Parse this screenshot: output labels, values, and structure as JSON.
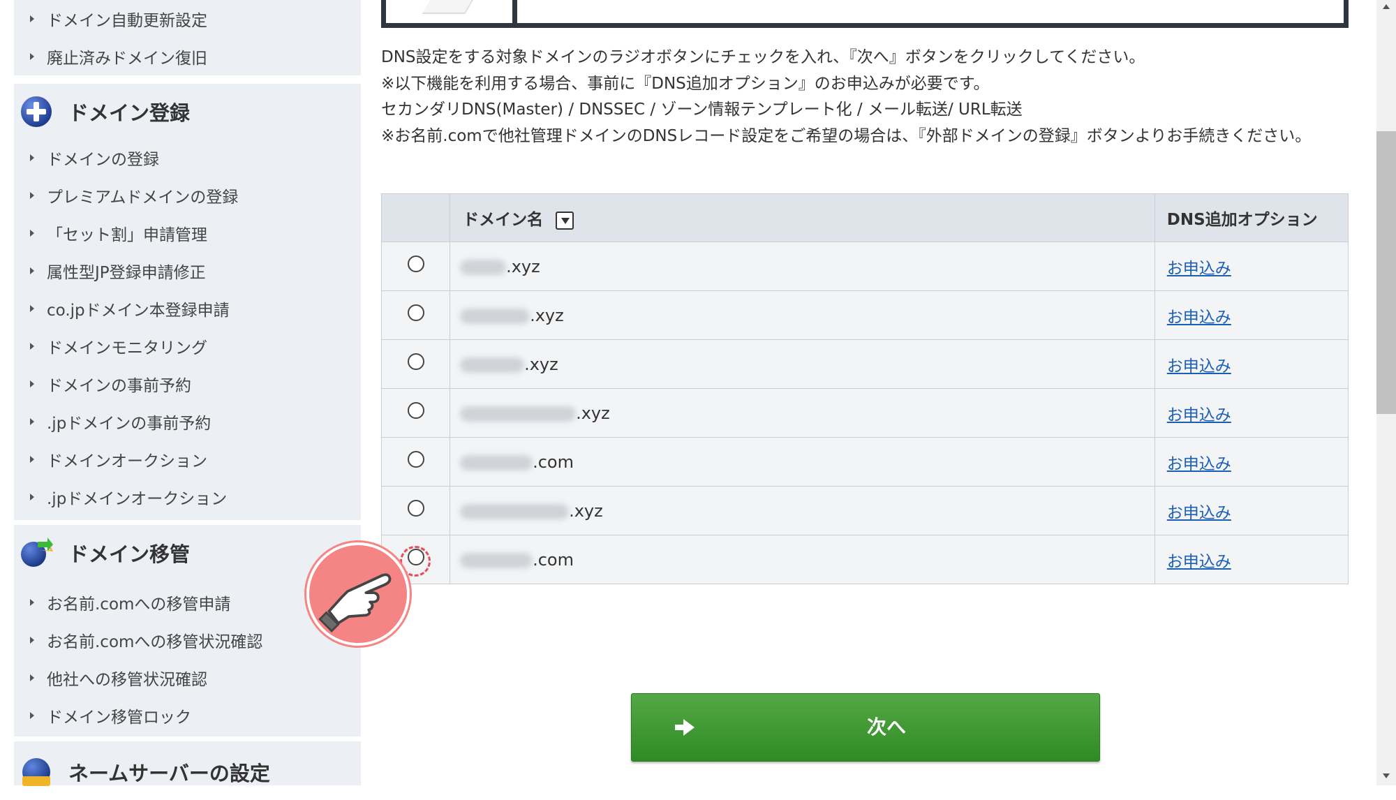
{
  "sidebar": {
    "renewal_items": [
      {
        "label": "ドメイン自動更新設定"
      },
      {
        "label": "廃止済みドメイン復旧"
      }
    ],
    "registration": {
      "title": "ドメイン登録",
      "items": [
        {
          "label": "ドメインの登録"
        },
        {
          "label": "プレミアムドメインの登録"
        },
        {
          "label": "「セット割」申請管理"
        },
        {
          "label": "属性型JP登録申請修正"
        },
        {
          "label": "co.jpドメイン本登録申請"
        },
        {
          "label": "ドメインモニタリング"
        },
        {
          "label": "ドメインの事前予約"
        },
        {
          "label": ".jpドメインの事前予約"
        },
        {
          "label": "ドメインオークション"
        },
        {
          "label": ".jpドメインオークション"
        }
      ]
    },
    "transfer": {
      "title": "ドメイン移管",
      "items": [
        {
          "label": "お名前.comへの移管申請"
        },
        {
          "label": "お名前.comへの移管状況確認"
        },
        {
          "label": "他社への移管状況確認"
        },
        {
          "label": "ドメイン移管ロック"
        }
      ]
    },
    "nameserver": {
      "title": "ネームサーバーの設定"
    }
  },
  "instructions": {
    "line1": "DNS設定をする対象ドメインのラジオボタンにチェックを入れ、『次へ』ボタンをクリックしてください。",
    "line2": "※以下機能を利用する場合、事前に『DNS追加オプション』のお申込みが必要です。",
    "line3": "セカンダリDNS(Master) / DNSSEC / ゾーン情報テンプレート化 / メール転送/ URL転送",
    "line4": "※お名前.comで他社管理ドメインのDNSレコード設定をご希望の場合は、『外部ドメインの登録』ボタンよりお手続きください。"
  },
  "table": {
    "headers": {
      "name": "ドメイン名",
      "option": "DNS追加オプション"
    },
    "rows": [
      {
        "suffix": ".xyz",
        "apply": "お申込み"
      },
      {
        "suffix": ".xyz",
        "apply": "お申込み"
      },
      {
        "suffix": ".xyz",
        "apply": "お申込み"
      },
      {
        "suffix": ".xyz",
        "apply": "お申込み"
      },
      {
        "suffix": ".com",
        "apply": "お申込み"
      },
      {
        "suffix": ".xyz",
        "apply": "お申込み"
      },
      {
        "suffix": ".com",
        "apply": "お申込み"
      }
    ]
  },
  "next_button": {
    "label": "次へ"
  },
  "colors": {
    "accent_green": "#3a9a2e",
    "link_blue": "#1a5fb4",
    "pointer_pink": "#f58485",
    "sidebar_bg": "#eceff3"
  },
  "icons": {
    "registration": "plus-circle-icon",
    "transfer": "globe-transfer-icon",
    "nameserver": "globe-server-icon",
    "pointer": "pointing-hand-icon",
    "next_arrow": "arrow-right-icon"
  }
}
